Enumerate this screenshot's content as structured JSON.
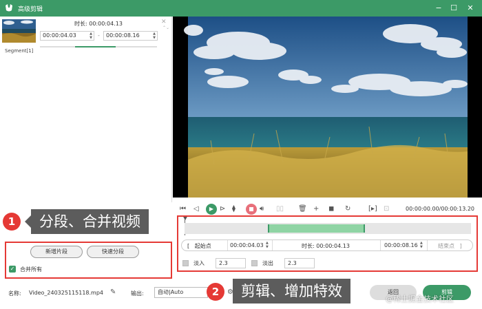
{
  "window": {
    "title": "高级剪辑",
    "minimize": "−",
    "maximize": "☐",
    "close": "✕"
  },
  "segment": {
    "label": "Segment[1]",
    "duration_label": "时长:",
    "duration_value": "00:00:04.13",
    "start_value": "00:00:04.03",
    "end_value": "00:00:08.16",
    "dash": "-",
    "close_icon": "✕",
    "arrows": "⌃⌄",
    "progress": 0.35
  },
  "preview": {
    "time_display": "00:00:00.00/00:00:13.20"
  },
  "controls": {
    "icons": [
      "first-frame-icon",
      "prev-frame-icon",
      "play-icon",
      "next-frame-icon",
      "mark-icon",
      "stop-icon",
      "volume-icon",
      "split-icon",
      "delete-icon",
      "add-icon",
      "copy-icon",
      "undo-icon",
      "bracket-icon",
      "snapshot-icon"
    ]
  },
  "trim": {
    "start_btn": "起始点",
    "start_value": "00:00:04.03",
    "duration_label": "时长:",
    "duration_value": "00:00:04.13",
    "end_value": "00:00:08.16",
    "end_btn": "结束点",
    "selection_start": 0.29,
    "selection_end": 0.63
  },
  "fade": {
    "fade_in_label": "淡入",
    "fade_in_value": "2.3",
    "fade_out_label": "淡出",
    "fade_out_value": "2.3"
  },
  "left_buttons": {
    "new_segment": "新增片段",
    "quick_split": "快速分段",
    "merge_all": "合并所有"
  },
  "bottom": {
    "name_label": "名称:",
    "name_value": "Video_240325115118.mp4",
    "output_label": "输出:",
    "output_value": "自动|Auto",
    "back_btn": "返回",
    "cut_btn": "剪辑"
  },
  "annotations": {
    "badge1": "1",
    "callout1": "分段、合并视频",
    "badge2": "2",
    "callout2": "剪辑、增加特效"
  },
  "watermark": "@稀土掘金技术社区",
  "colors": {
    "accent": "#3c9a67",
    "stop": "#e8707b",
    "annotation_red": "#e53935"
  }
}
